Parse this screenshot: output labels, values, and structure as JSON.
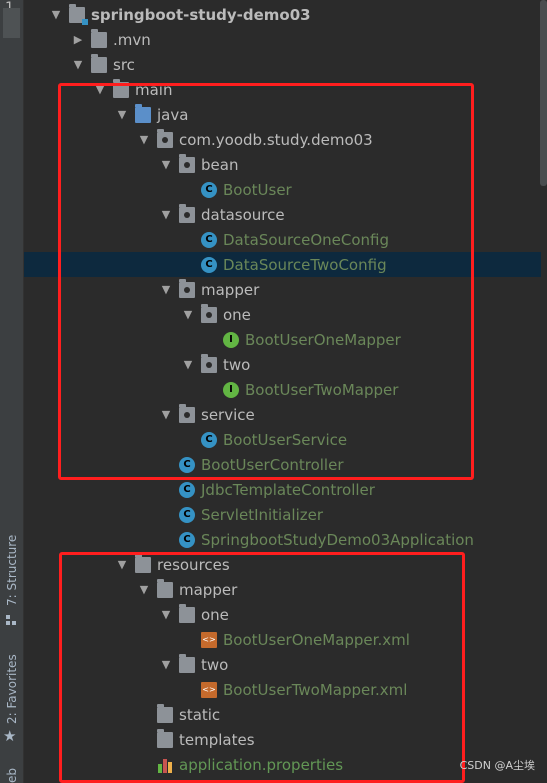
{
  "sidebar": {
    "top_number": "1",
    "structure_label": "7: Structure",
    "favorites_label": "2: Favorites",
    "bottom_label": "eb"
  },
  "tree": [
    {
      "label": "springboot-study-demo03",
      "level": 0,
      "arrow": "down",
      "icon": "module-folder",
      "style": "bold"
    },
    {
      "label": ".mvn",
      "level": 1,
      "arrow": "right",
      "icon": "folder"
    },
    {
      "label": "src",
      "level": 1,
      "arrow": "down",
      "icon": "folder"
    },
    {
      "label": "main",
      "level": 2,
      "arrow": "down",
      "icon": "folder"
    },
    {
      "label": "java",
      "level": 3,
      "arrow": "down",
      "icon": "source-folder"
    },
    {
      "label": "com.yoodb.study.demo03",
      "level": 4,
      "arrow": "down",
      "icon": "package"
    },
    {
      "label": "bean",
      "level": 5,
      "arrow": "down",
      "icon": "package"
    },
    {
      "label": "BootUser",
      "level": 6,
      "arrow": "none",
      "icon": "class",
      "style": "green"
    },
    {
      "label": "datasource",
      "level": 5,
      "arrow": "down",
      "icon": "package"
    },
    {
      "label": "DataSourceOneConfig",
      "level": 6,
      "arrow": "none",
      "icon": "class",
      "style": "green"
    },
    {
      "label": "DataSourceTwoConfig",
      "level": 6,
      "arrow": "none",
      "icon": "class",
      "style": "green",
      "selected": true
    },
    {
      "label": "mapper",
      "level": 5,
      "arrow": "down",
      "icon": "package"
    },
    {
      "label": "one",
      "level": 6,
      "arrow": "down",
      "icon": "package"
    },
    {
      "label": "BootUserOneMapper",
      "level": 7,
      "arrow": "none",
      "icon": "interface",
      "style": "green"
    },
    {
      "label": "two",
      "level": 6,
      "arrow": "down",
      "icon": "package"
    },
    {
      "label": "BootUserTwoMapper",
      "level": 7,
      "arrow": "none",
      "icon": "interface",
      "style": "green"
    },
    {
      "label": "service",
      "level": 5,
      "arrow": "down",
      "icon": "package"
    },
    {
      "label": "BootUserService",
      "level": 6,
      "arrow": "none",
      "icon": "class",
      "style": "green"
    },
    {
      "label": "BootUserController",
      "level": 5,
      "arrow": "none",
      "icon": "class",
      "style": "green"
    },
    {
      "label": "JdbcTemplateController",
      "level": 5,
      "arrow": "none",
      "icon": "class",
      "style": "green"
    },
    {
      "label": "ServletInitializer",
      "level": 5,
      "arrow": "none",
      "icon": "class",
      "style": "green"
    },
    {
      "label": "SpringbootStudyDemo03Application",
      "level": 5,
      "arrow": "none",
      "icon": "class",
      "style": "green"
    },
    {
      "label": "resources",
      "level": 3,
      "arrow": "down",
      "icon": "folder"
    },
    {
      "label": "mapper",
      "level": 4,
      "arrow": "down",
      "icon": "folder"
    },
    {
      "label": "one",
      "level": 5,
      "arrow": "down",
      "icon": "folder"
    },
    {
      "label": "BootUserOneMapper.xml",
      "level": 6,
      "arrow": "none",
      "icon": "xml",
      "style": "green"
    },
    {
      "label": "two",
      "level": 5,
      "arrow": "down",
      "icon": "folder"
    },
    {
      "label": "BootUserTwoMapper.xml",
      "level": 6,
      "arrow": "none",
      "icon": "xml",
      "style": "green"
    },
    {
      "label": "static",
      "level": 4,
      "arrow": "none",
      "icon": "folder"
    },
    {
      "label": "templates",
      "level": 4,
      "arrow": "none",
      "icon": "folder"
    },
    {
      "label": "application.properties",
      "level": 4,
      "arrow": "none",
      "icon": "properties",
      "style": "greenb"
    }
  ],
  "colors": {
    "highlight_box": "#ff1e1e",
    "selection": "#0d293e",
    "class_icon": "#3592c4",
    "interface_icon": "#62b543"
  },
  "icon_letters": {
    "class": "C",
    "interface": "I",
    "xml": "<>"
  },
  "watermark": "CSDN @A尘埃"
}
